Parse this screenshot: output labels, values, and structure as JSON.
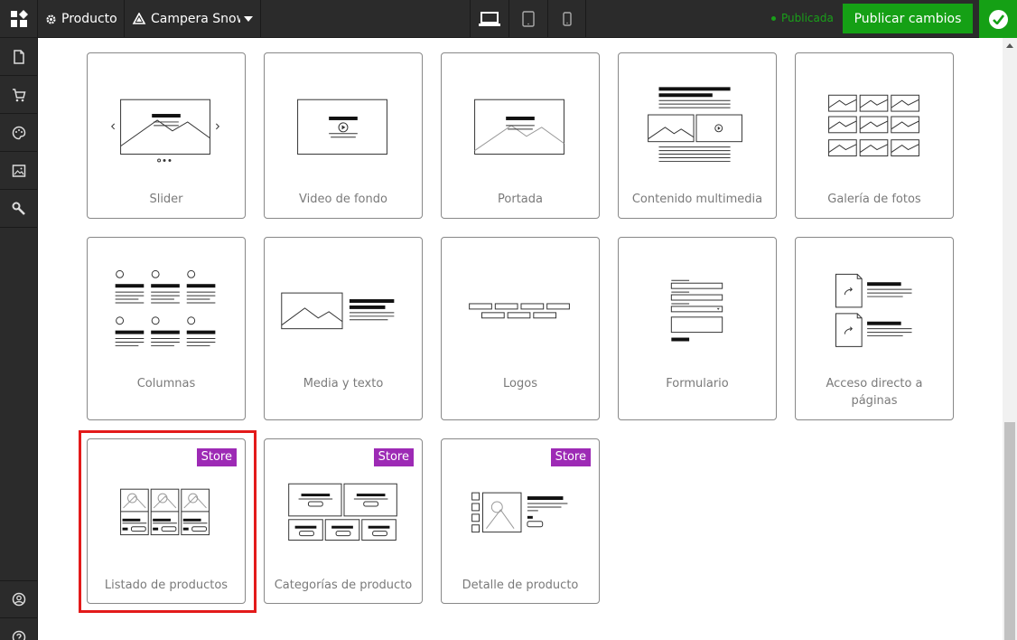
{
  "header": {
    "producto_label": "Producto",
    "campera_label": "Campera Snow",
    "status": "Publicada",
    "publish_label": "Publicar cambios"
  },
  "cards": [
    {
      "label": "Slider"
    },
    {
      "label": "Video de fondo"
    },
    {
      "label": "Portada"
    },
    {
      "label": "Contenido multimedia"
    },
    {
      "label": "Galería de fotos"
    },
    {
      "label": "Columnas"
    },
    {
      "label": "Media y texto"
    },
    {
      "label": "Logos"
    },
    {
      "label": "Formulario"
    },
    {
      "label": "Acceso directo a páginas"
    },
    {
      "label": "Listado de productos",
      "badge": "Store"
    },
    {
      "label": "Categorías de producto",
      "badge": "Store"
    },
    {
      "label": "Detalle de producto",
      "badge": "Store"
    }
  ],
  "colors": {
    "topbar": "#2b2b2b",
    "publish": "#15a015",
    "badge": "#9d2ab5",
    "highlight": "#e31a1a"
  }
}
